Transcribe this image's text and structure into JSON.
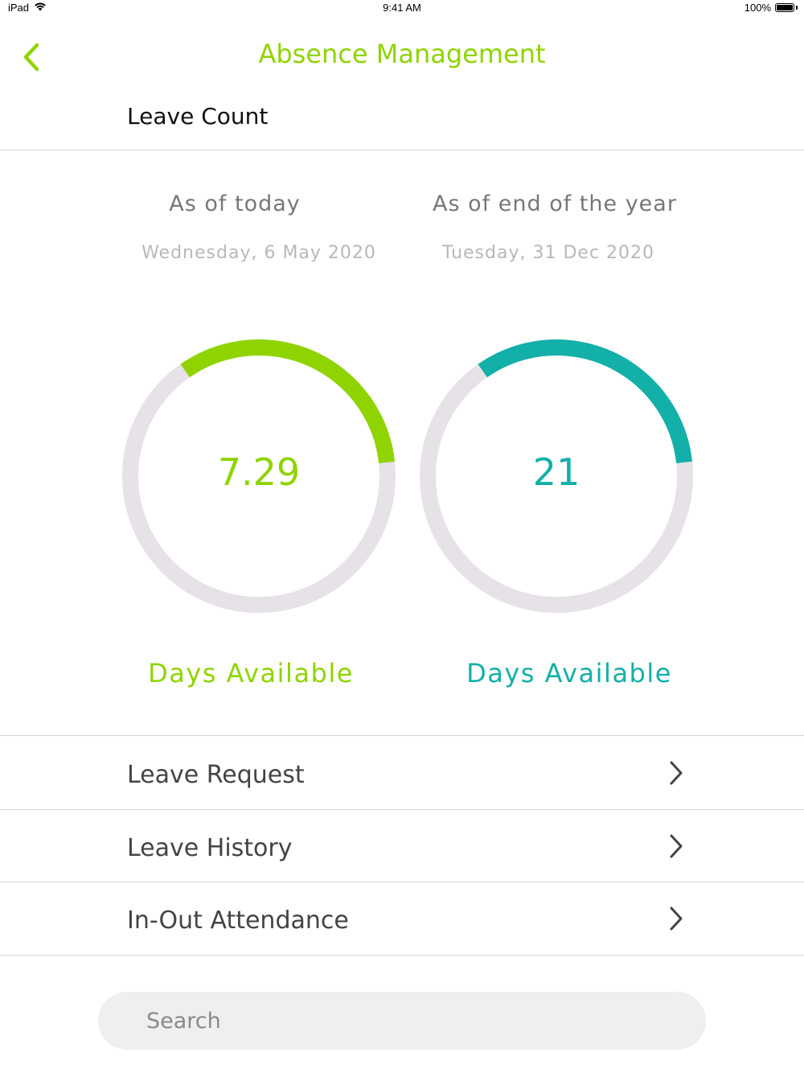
{
  "status_bar": {
    "device": "iPad",
    "time": "9:41 AM",
    "battery": "100%",
    "battery_level": 1.0
  },
  "nav": {
    "title": "Absence Management",
    "back_icon": "chevron-left-icon"
  },
  "section_title": "Leave Count",
  "columns": [
    {
      "heading": "As of today",
      "date": "Wednesday, 6 May 2020",
      "value": "7.29",
      "label": "Days Available",
      "color": "#8fd400",
      "progress_fraction": 0.33
    },
    {
      "heading": "As of end of the year",
      "date": "Tuesday, 31 Dec 2020",
      "value": "21",
      "label": "Days Available",
      "color": "#12b0a8",
      "progress_fraction": 0.33
    }
  ],
  "track_color": "#e6e2e8",
  "menu": [
    {
      "label": "Leave Request",
      "icon": "chevron-right-icon"
    },
    {
      "label": "Leave History",
      "icon": "chevron-right-icon"
    },
    {
      "label": "In-Out Attendance",
      "icon": "chevron-right-icon"
    }
  ],
  "search": {
    "placeholder": "Search"
  }
}
